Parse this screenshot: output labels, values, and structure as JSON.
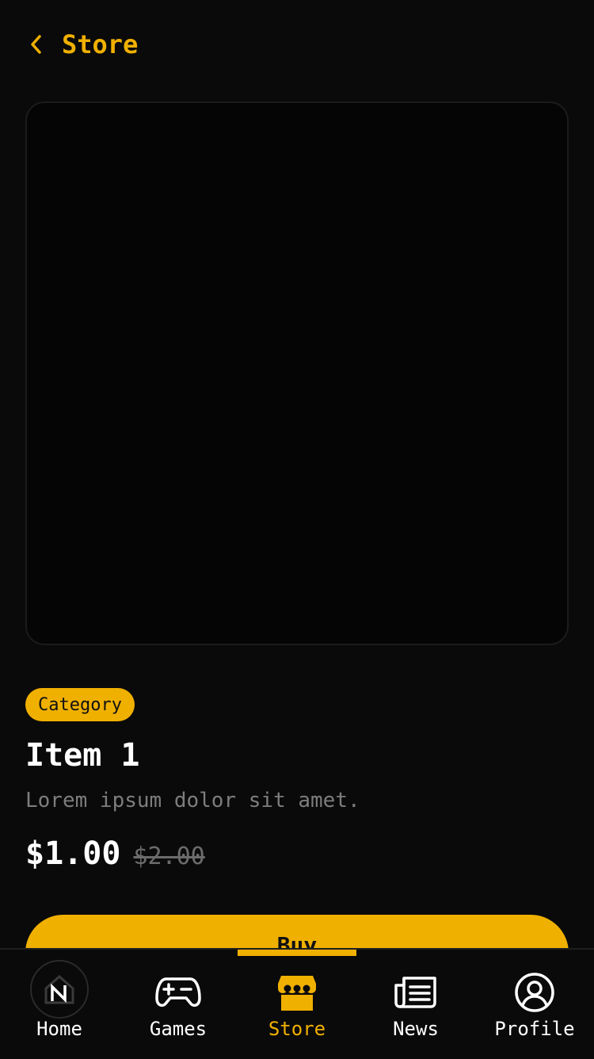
{
  "header": {
    "title": "Store",
    "back_icon": "chevron-left-icon"
  },
  "product": {
    "category": "Category",
    "title": "Item 1",
    "description": "Lorem ipsum dolor sit amet.",
    "price": "$1.00",
    "original_price": "$2.00"
  },
  "actions": {
    "buy_label": "Buy"
  },
  "colors": {
    "accent": "#f0b000",
    "background": "#0a0a0a"
  },
  "tabbar": {
    "tabs": [
      {
        "label": "Home",
        "icon": "home-logo-icon",
        "active": false
      },
      {
        "label": "Games",
        "icon": "gamepad-icon",
        "active": false
      },
      {
        "label": "Store",
        "icon": "storefront-icon",
        "active": true
      },
      {
        "label": "News",
        "icon": "newspaper-icon",
        "active": false
      },
      {
        "label": "Profile",
        "icon": "user-circle-icon",
        "active": false
      }
    ]
  }
}
